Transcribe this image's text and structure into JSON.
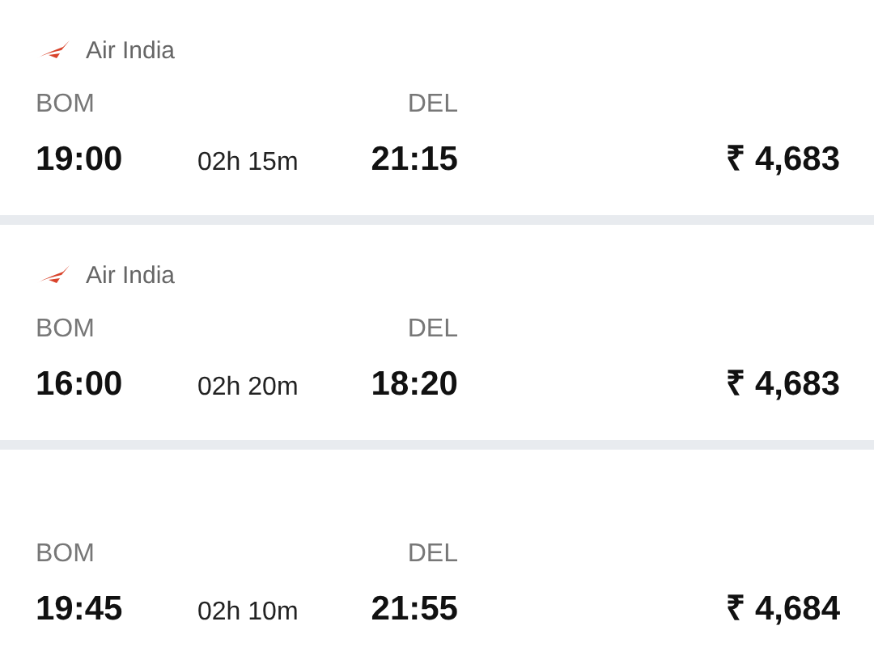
{
  "flights": [
    {
      "airline": "Air India",
      "from": "BOM",
      "to": "DEL",
      "departure": "19:00",
      "duration": "02h 15m",
      "arrival": "21:15",
      "price": "₹ 4,683"
    },
    {
      "airline": "Air India",
      "from": "BOM",
      "to": "DEL",
      "departure": "16:00",
      "duration": "02h 20m",
      "arrival": "18:20",
      "price": "₹ 4,683"
    },
    {
      "from": "BOM",
      "to": "DEL",
      "departure": "19:45",
      "duration": "02h 10m",
      "arrival": "21:55",
      "price": "₹ 4,684"
    }
  ]
}
